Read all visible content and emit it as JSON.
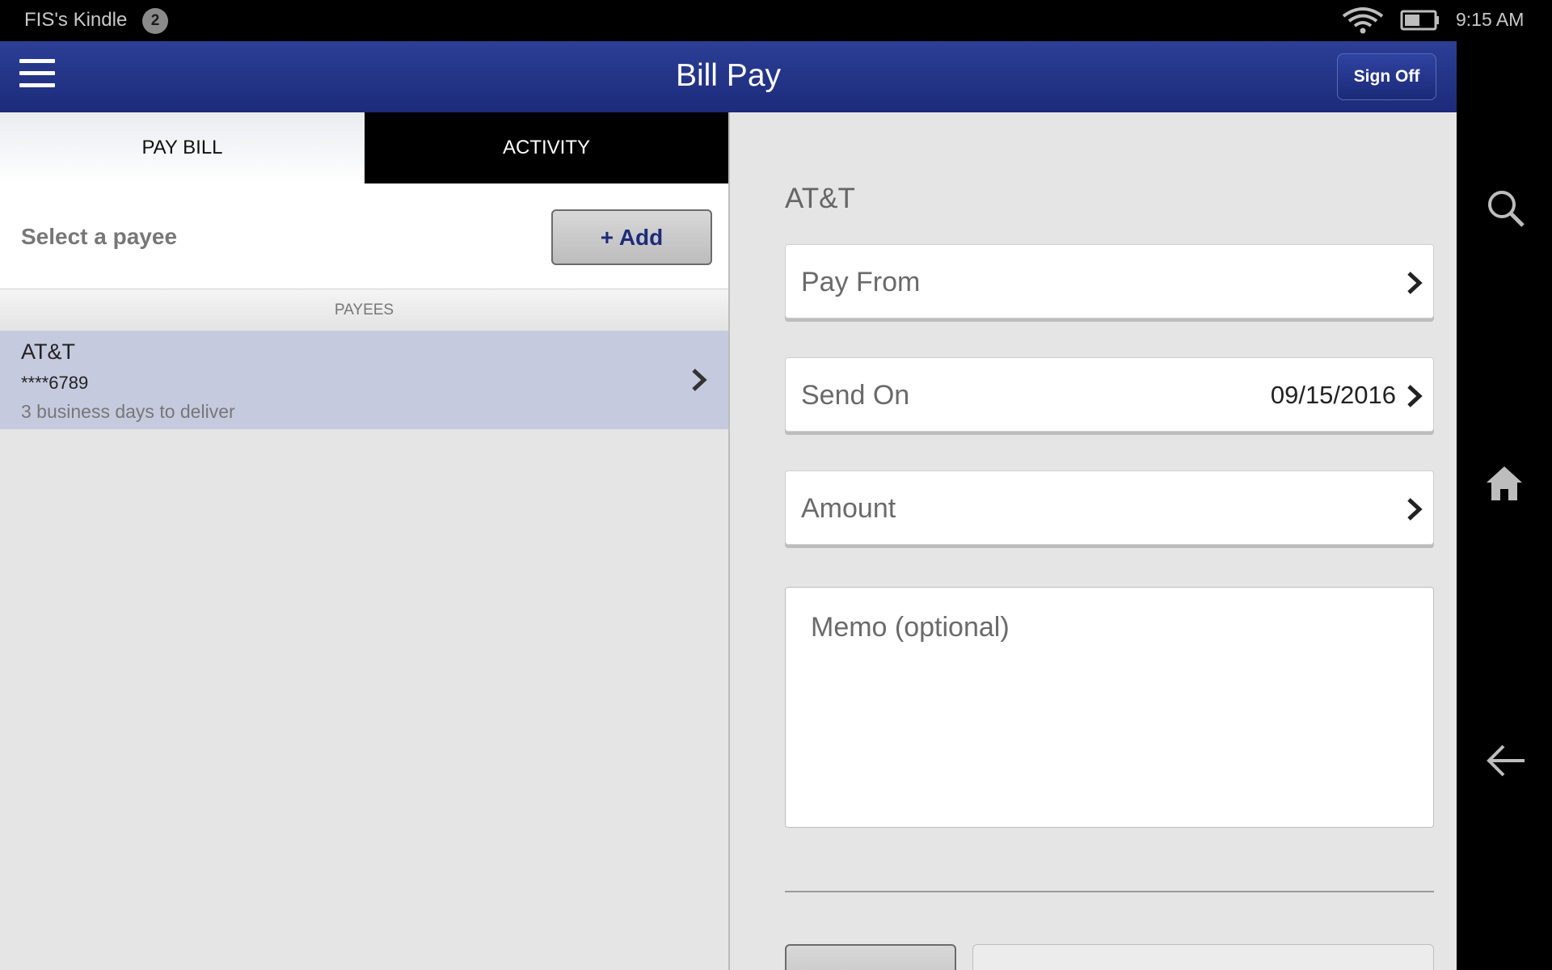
{
  "status_bar": {
    "device_name": "FIS's Kindle",
    "notification_count": "2",
    "time": "9:15 AM"
  },
  "header": {
    "title": "Bill Pay",
    "sign_off_label": "Sign Off"
  },
  "tabs": [
    {
      "label": "PAY BILL",
      "selected": true
    },
    {
      "label": "ACTIVITY",
      "selected": false
    }
  ],
  "payee_panel": {
    "select_label": "Select a payee",
    "add_label": "+ Add",
    "section_header": "PAYEES",
    "payees": [
      {
        "name": "AT&T",
        "account": "****6789",
        "delivery": "3 business days to deliver"
      }
    ]
  },
  "payment_form": {
    "payee_name": "AT&T",
    "pay_from_label": "Pay From",
    "send_on_label": "Send On",
    "send_on_value": "09/15/2016",
    "amount_label": "Amount",
    "memo_placeholder": "Memo (optional)"
  },
  "colors": {
    "header_blue": "#1c2b7a",
    "selected_row": "#c6cadf",
    "panel_bg": "#e5e5e5"
  },
  "nav_icons": [
    "search-icon",
    "home-icon",
    "back-arrow-icon"
  ]
}
